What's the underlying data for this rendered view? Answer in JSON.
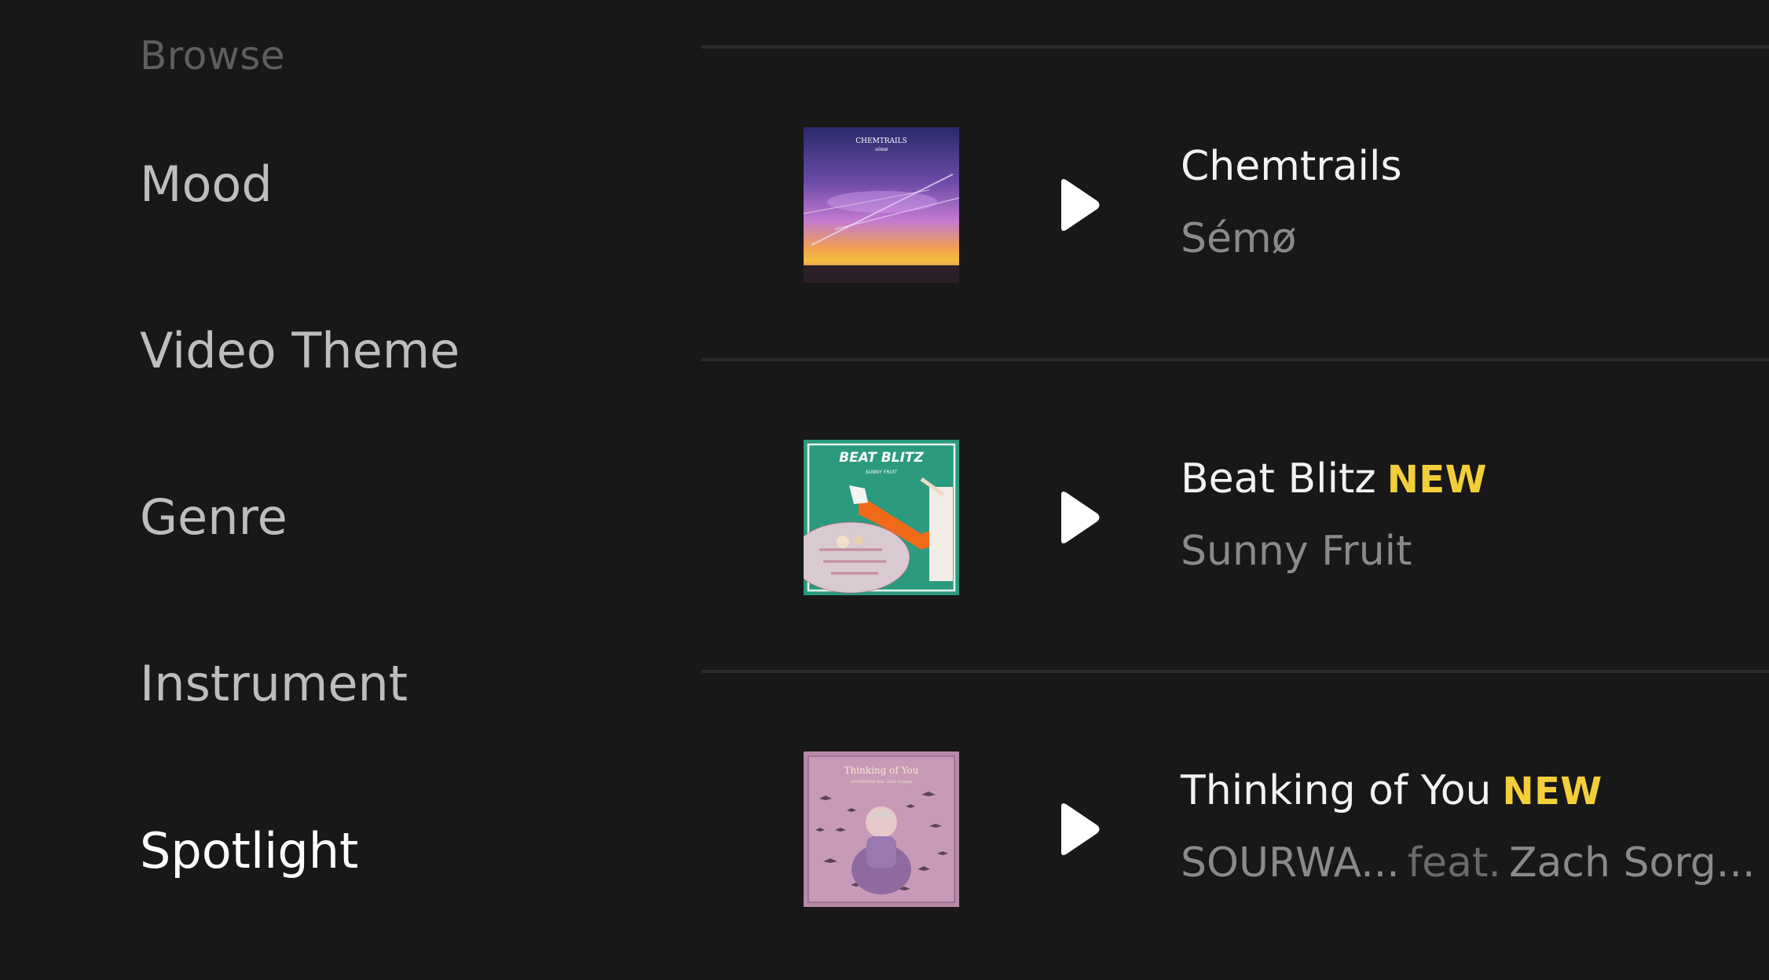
{
  "sidebar": {
    "heading": "Browse",
    "items": [
      {
        "label": "Mood",
        "active": false
      },
      {
        "label": "Video Theme",
        "active": false
      },
      {
        "label": "Genre",
        "active": false
      },
      {
        "label": "Instrument",
        "active": false
      },
      {
        "label": "Spotlight",
        "active": true
      }
    ]
  },
  "tracks": [
    {
      "title": "Chemtrails",
      "badge": "",
      "artist": "Sémø",
      "feat_label": "",
      "feat_artist": "",
      "cover_text": "CHEMTRAILS",
      "cover_subtext": "sémø",
      "play_icon": "play-icon"
    },
    {
      "title": "Beat Blitz",
      "badge": "NEW",
      "artist": "Sunny Fruit",
      "feat_label": "",
      "feat_artist": "",
      "cover_text": "BEAT BLITZ",
      "cover_subtext": "SUNNY FRUIT",
      "play_icon": "play-icon"
    },
    {
      "title": "Thinking of You",
      "badge": "NEW",
      "artist": "SOURWA...",
      "feat_label": "feat.",
      "feat_artist": "Zach Sorg...",
      "cover_text": "Thinking of You",
      "cover_subtext": "SOURWAVE feat. Zach Sorgen",
      "play_icon": "play-icon"
    }
  ],
  "colors": {
    "background": "#181818",
    "badge": "#f2cf3a",
    "active_text": "#ffffff",
    "inactive_text": "#bdbdbd"
  }
}
